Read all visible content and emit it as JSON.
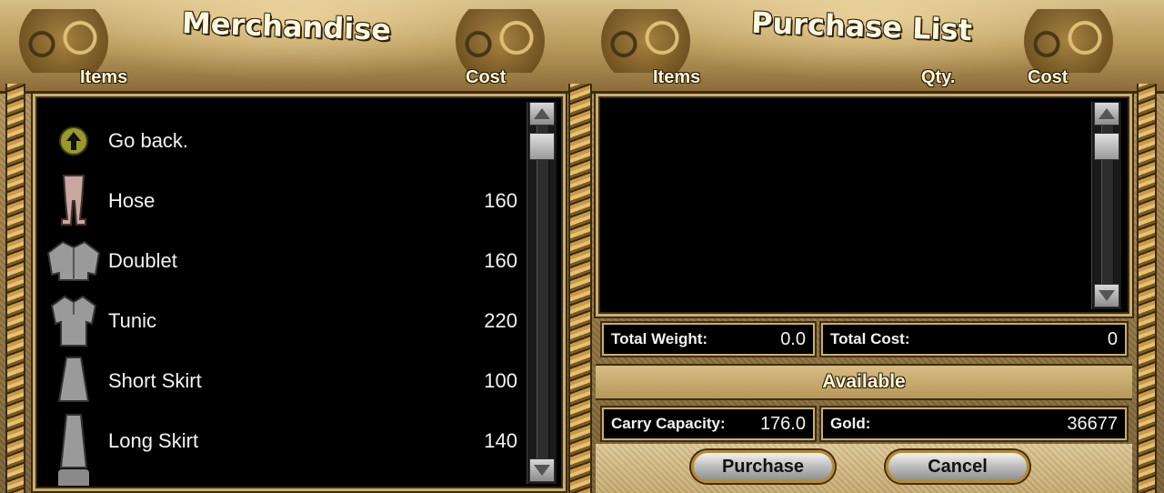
{
  "merchandise": {
    "title": "Merchandise",
    "col_items": "Items",
    "col_cost": "Cost",
    "items": [
      {
        "name": "Go back.",
        "cost": "",
        "icon": "go-back-arrow-icon"
      },
      {
        "name": "Hose",
        "cost": "160",
        "icon": "hose-icon"
      },
      {
        "name": "Doublet",
        "cost": "160",
        "icon": "doublet-icon"
      },
      {
        "name": "Tunic",
        "cost": "220",
        "icon": "tunic-icon"
      },
      {
        "name": "Short Skirt",
        "cost": "100",
        "icon": "short-skirt-icon"
      },
      {
        "name": "Long Skirt",
        "cost": "140",
        "icon": "long-skirt-icon"
      }
    ]
  },
  "purchase_list": {
    "title": "Purchase List",
    "col_items": "Items",
    "col_qty": "Qty.",
    "col_cost": "Cost",
    "total_weight_label": "Total Weight:",
    "total_weight_value": "0.0",
    "total_cost_label": "Total Cost:",
    "total_cost_value": "0"
  },
  "available": {
    "title": "Available",
    "carry_capacity_label": "Carry Capacity:",
    "carry_capacity_value": "176.0",
    "gold_label": "Gold:",
    "gold_value": "36677"
  },
  "buttons": {
    "purchase": "Purchase",
    "cancel": "Cancel"
  },
  "colors": {
    "parchment": "#b9995b",
    "panel_bg": "#000000",
    "text": "#f3f3f3"
  }
}
